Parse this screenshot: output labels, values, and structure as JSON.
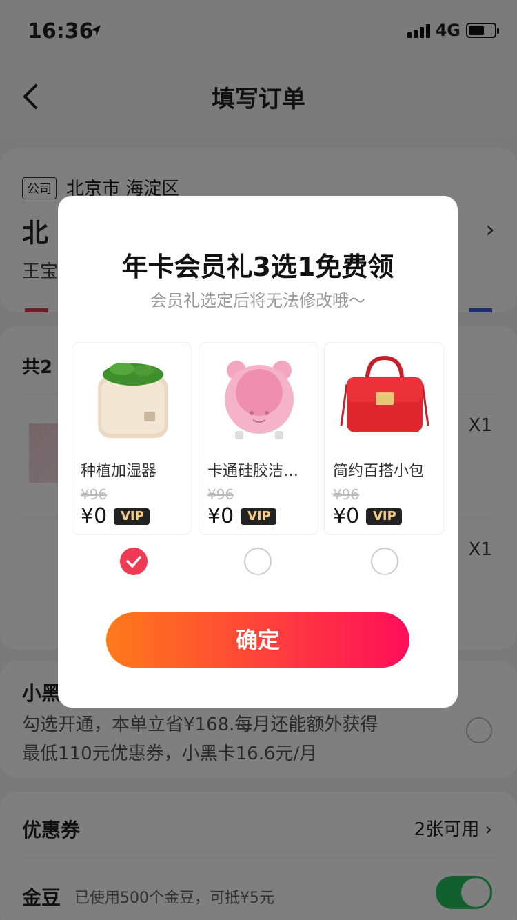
{
  "status": {
    "time": "16:36",
    "network": "4G"
  },
  "nav": {
    "title": "填写订单"
  },
  "address": {
    "tag": "公司",
    "region": "北京市 海淀区",
    "name": "北",
    "person": "王宝"
  },
  "goods": {
    "count_text": "共2",
    "items": [
      {
        "qty": "X1"
      },
      {
        "qty": "X1"
      }
    ]
  },
  "vip": {
    "title": "小黑",
    "desc_line1": "勾选开通，本单立省¥168.每月还能额外获得",
    "desc_line2": "最低110元优惠券，小黑卡16.6元/月"
  },
  "coupon": {
    "label": "优惠券",
    "value": "2张可用"
  },
  "beans": {
    "label": "金豆",
    "desc": "已使用500个金豆，可抵¥5元",
    "enabled": true
  },
  "modal": {
    "title": "年卡会员礼3选1免费领",
    "subtitle": "会员礼选定后将无法修改哦～",
    "gifts": [
      {
        "name": "种植加湿器",
        "original_price": "¥96",
        "price": "¥0",
        "tag": "VIP",
        "selected": true
      },
      {
        "name": "卡通硅胶洁面仪",
        "original_price": "¥96",
        "price": "¥0",
        "tag": "VIP",
        "selected": false
      },
      {
        "name": "简约百搭小包",
        "original_price": "¥96",
        "price": "¥0",
        "tag": "VIP",
        "selected": false
      }
    ],
    "confirm_label": "确定"
  },
  "colors": {
    "accent": "#ef3a56",
    "button_start": "#ff7a1a",
    "button_end": "#ff0e5a",
    "toggle_on": "#24c060"
  }
}
